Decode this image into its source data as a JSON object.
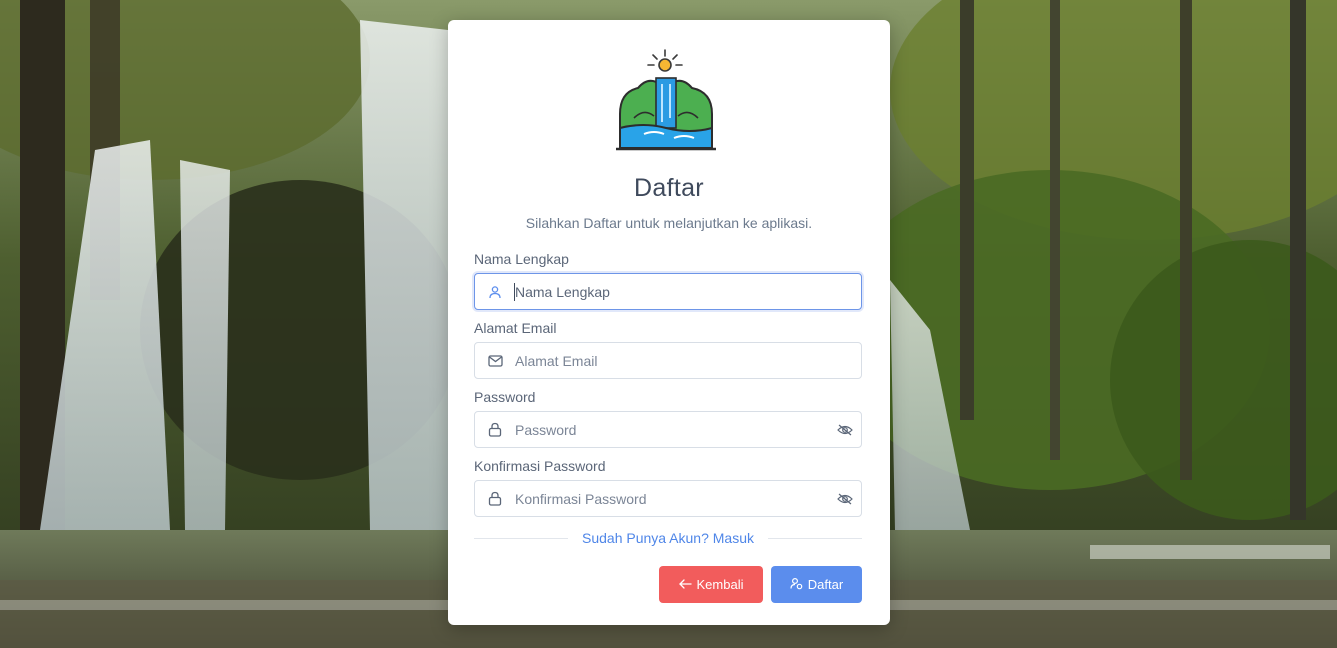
{
  "form": {
    "title": "Daftar",
    "subtitle": "Silahkan Daftar untuk melanjutkan ke aplikasi.",
    "fields": [
      {
        "label": "Nama Lengkap",
        "placeholder": "Nama Lengkap",
        "value": "",
        "icon": "user-icon"
      },
      {
        "label": "Alamat Email",
        "placeholder": "Alamat Email",
        "value": "",
        "icon": "mail-icon"
      },
      {
        "label": "Password",
        "placeholder": "Password",
        "value": "",
        "icon": "lock-icon",
        "toggle_icon": "eye-off-icon"
      },
      {
        "label": "Konfirmasi Password",
        "placeholder": "Konfirmasi Password",
        "value": "",
        "icon": "lock-icon",
        "toggle_icon": "eye-off-icon"
      }
    ],
    "login_link": "Sudah Punya Akun? Masuk",
    "back_button": "Kembali",
    "submit_button": "Daftar"
  },
  "colors": {
    "back_button": "#f25c5c",
    "submit_button": "#5b8ded",
    "link": "#4f86e8",
    "focus_border": "#6d95e8"
  }
}
